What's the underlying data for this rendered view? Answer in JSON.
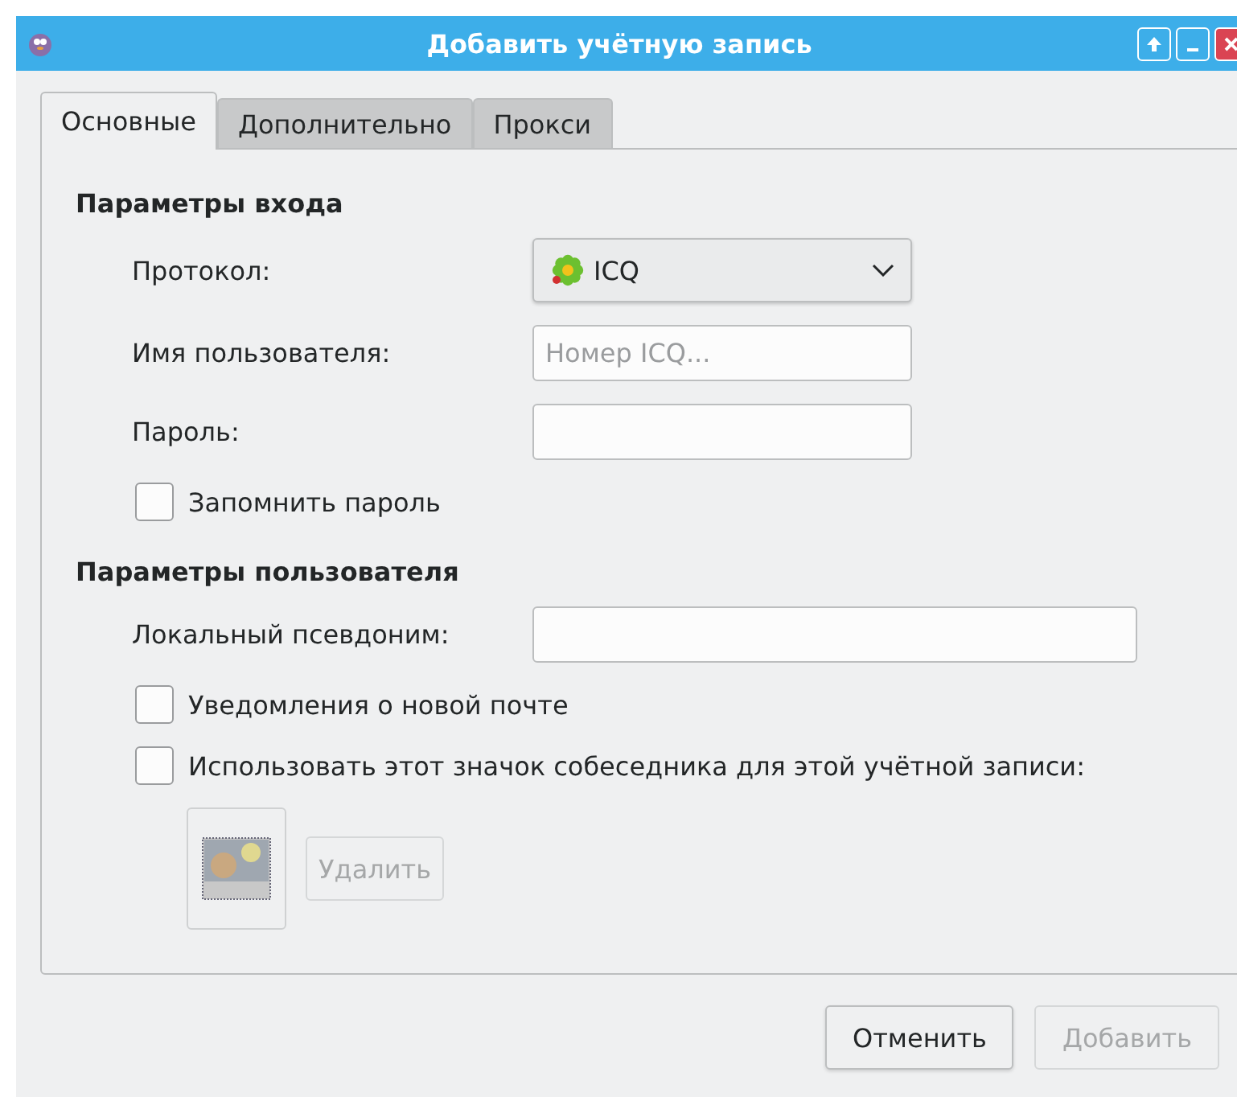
{
  "window": {
    "title": "Добавить учётную запись",
    "buttons": [
      {
        "kind": "up"
      },
      {
        "kind": "minimize"
      },
      {
        "kind": "close"
      }
    ]
  },
  "tabs": [
    {
      "label": "Основные",
      "selected": true
    },
    {
      "label": "Дополнительно",
      "selected": false
    },
    {
      "label": "Прокси",
      "selected": false
    }
  ],
  "sections": [
    {
      "title": "Параметры входа",
      "rows": [
        {
          "kind": "select",
          "label": "Протокол:",
          "value": "ICQ"
        },
        {
          "kind": "input",
          "label": "Имя пользователя:",
          "placeholder": "Номер ICQ..."
        },
        {
          "kind": "input",
          "label": "Пароль:"
        },
        {
          "kind": "checkbox",
          "label": "Запомнить пароль",
          "checked": false
        }
      ]
    },
    {
      "title": "Параметры пользователя",
      "rows": [
        {
          "kind": "input",
          "label": "Локальный псевдоним:",
          "wide": true
        },
        {
          "kind": "checkbox",
          "label": "Уведомления о новой почте",
          "checked": false
        },
        {
          "kind": "checkbox",
          "label": "Использовать этот значок собеседника для этой учётной записи:",
          "checked": false
        },
        {
          "kind": "icon",
          "button": "Удалить",
          "disabled": true
        }
      ]
    }
  ],
  "buttons": [
    {
      "label": "Отменить",
      "disabled": false
    },
    {
      "label": "Добавить",
      "disabled": true
    }
  ]
}
